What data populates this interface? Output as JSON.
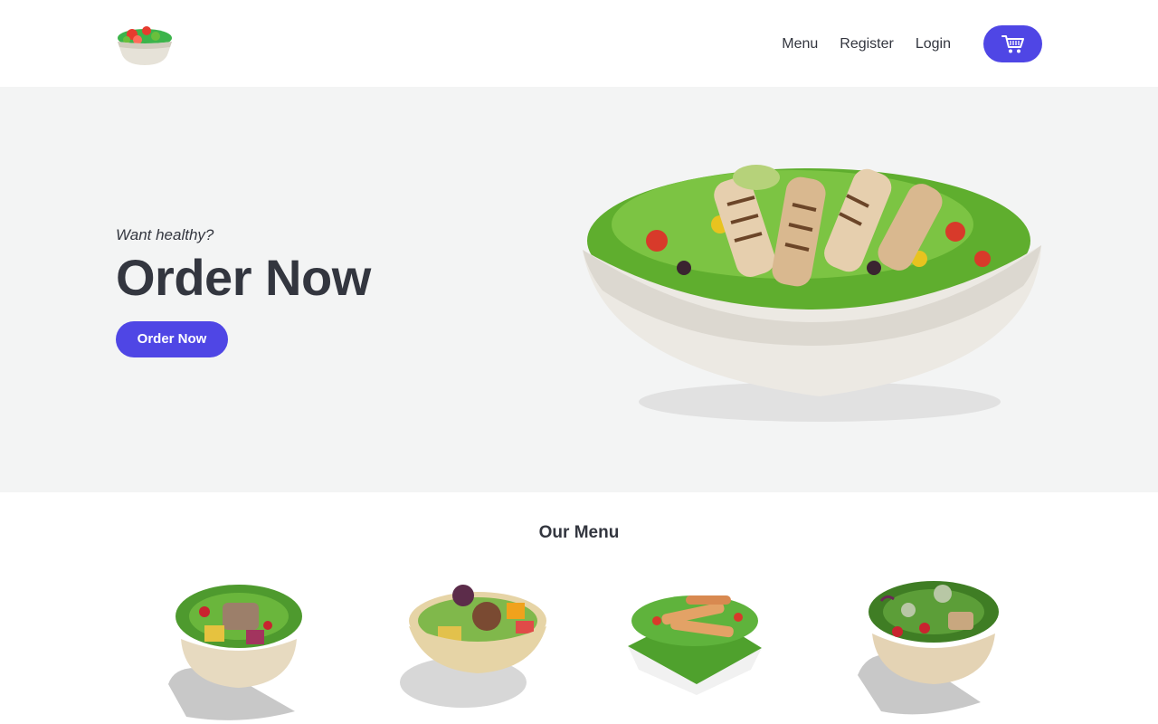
{
  "header": {
    "logo_name": "salad-bowl-logo",
    "nav": [
      {
        "label": "Menu"
      },
      {
        "label": "Register"
      },
      {
        "label": "Login"
      }
    ],
    "cart_icon": "cart-icon"
  },
  "hero": {
    "tagline": "Want healthy?",
    "title": "Order Now",
    "button_label": "Order Now"
  },
  "menu": {
    "title": "Our Menu",
    "items": [
      {
        "icon": "salad-bowl-1"
      },
      {
        "icon": "salad-bowl-2"
      },
      {
        "icon": "salad-bowl-3"
      },
      {
        "icon": "salad-bowl-4"
      }
    ]
  },
  "colors": {
    "accent": "#4f46e5",
    "hero_bg": "#f3f4f4",
    "text": "#33363f"
  }
}
